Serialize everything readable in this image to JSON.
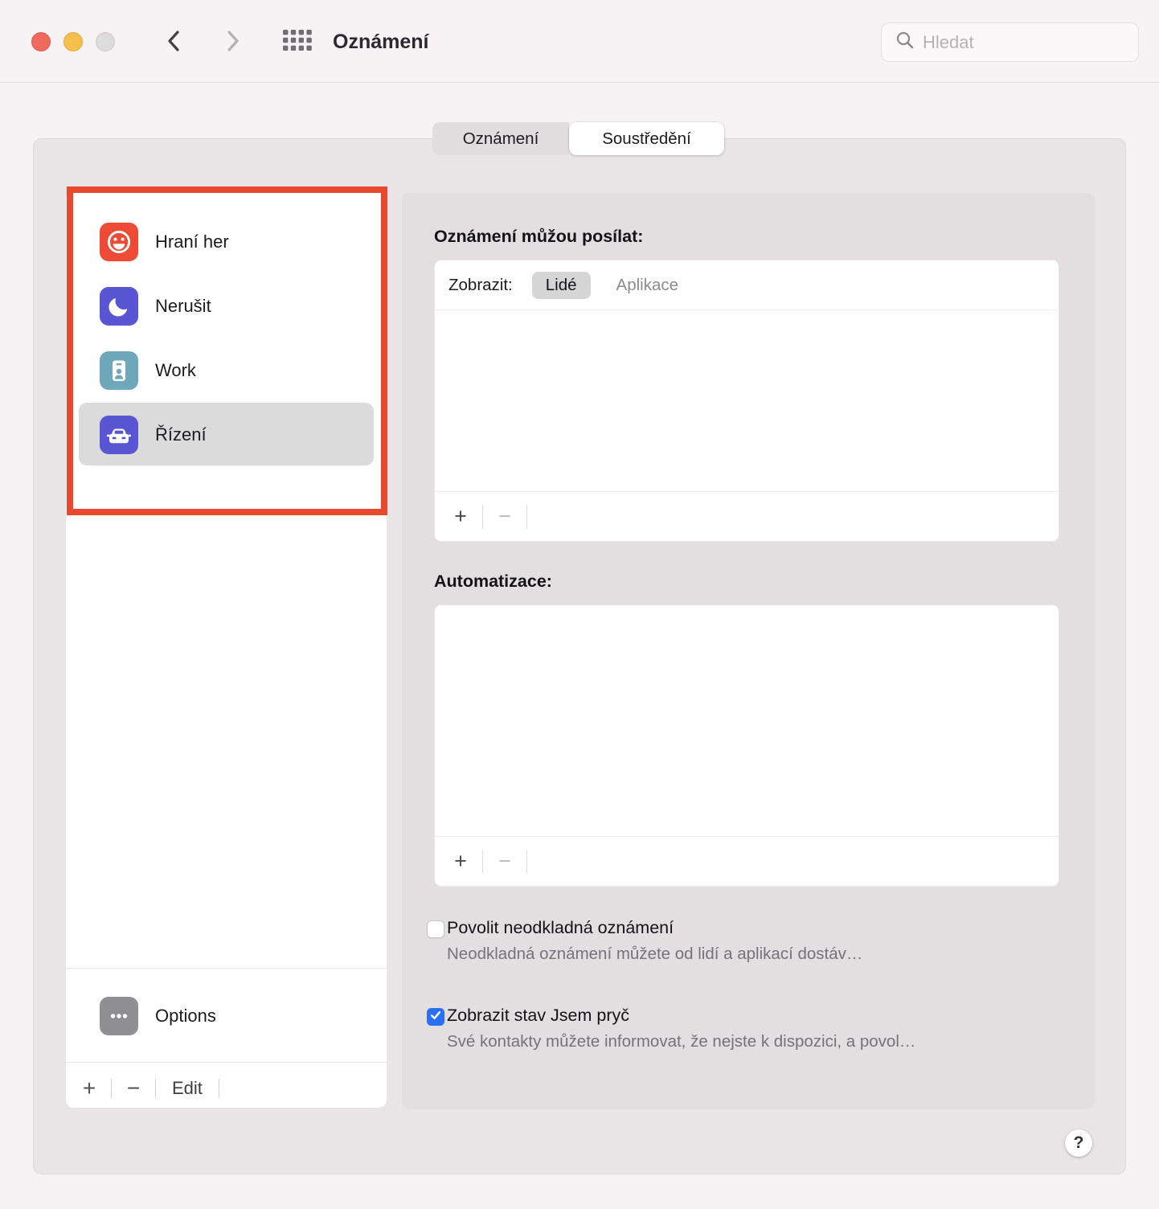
{
  "titlebar": {
    "title": "Oznámení",
    "search_placeholder": "Hledat"
  },
  "tabs": {
    "notifications": "Oznámení",
    "focus": "Soustředění"
  },
  "sidebar": {
    "items": [
      {
        "label": "Hraní her",
        "icon": "gaming-smiley-icon",
        "color": "#ee4b36",
        "selected": false
      },
      {
        "label": "Nerušit",
        "icon": "moon-icon",
        "color": "#5a55d2",
        "selected": false
      },
      {
        "label": "Work",
        "icon": "id-badge-icon",
        "color": "#6fa8ba",
        "selected": false
      },
      {
        "label": "Řízení",
        "icon": "car-icon",
        "color": "#5a55d2",
        "selected": true
      }
    ],
    "options_label": "Options",
    "footer": {
      "add": "+",
      "remove": "−",
      "edit": "Edit"
    }
  },
  "panel": {
    "allow_heading": "Oznámení můžou posílat:",
    "show_label": "Zobrazit:",
    "people_filter": "Lidé",
    "apps_filter": "Aplikace",
    "automation_heading": "Automatizace:",
    "list_add": "+",
    "list_remove": "−",
    "urgent_checkbox": {
      "label": "Povolit neodkladná oznámení",
      "description": "Neodkladná oznámení můžete od lidí a aplikací dostáv…",
      "checked": false
    },
    "away_checkbox": {
      "label": "Zobrazit stav Jsem pryč",
      "description": "Své kontakty můžete informovat, že nejste k dispozici, a povol…",
      "checked": true
    },
    "help": "?"
  },
  "colors": {
    "gaming_icon": "#ee4b36",
    "dnd_icon": "#5a55d2",
    "work_icon": "#6fa8ba",
    "driving_icon": "#5a55d2",
    "options_icon": "#8e8e93",
    "checkbox_checked": "#2b6ff2",
    "annotation_red": "#e8492e",
    "selected_row": "#dcdbdc"
  }
}
